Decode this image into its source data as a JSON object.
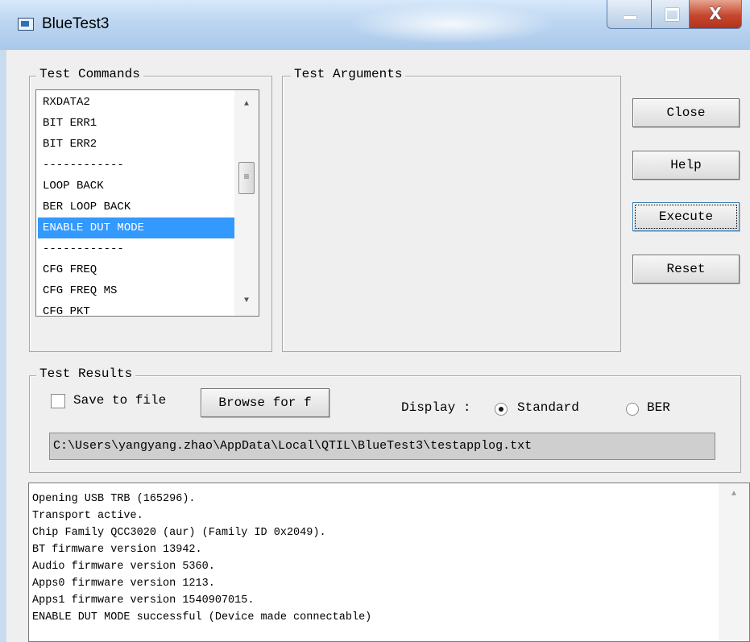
{
  "window": {
    "title": "BlueTest3",
    "controls": {
      "minimize": "",
      "maximize": "",
      "close": "X"
    }
  },
  "test_commands": {
    "legend": "Test Commands",
    "items": [
      "RXDATA2",
      "BIT ERR1",
      "BIT ERR2",
      "------------",
      "LOOP BACK",
      "BER LOOP BACK",
      "ENABLE DUT MODE",
      "------------",
      "CFG FREQ",
      "CFG FREQ MS",
      "CFG PKT"
    ],
    "selected_index": 6
  },
  "test_arguments": {
    "legend": "Test Arguments"
  },
  "buttons": {
    "close": "Close",
    "help": "Help",
    "execute": "Execute",
    "reset": "Reset"
  },
  "test_results": {
    "legend": "Test Results",
    "save_to_file_label": "Save to file",
    "save_to_file_checked": false,
    "browse_label": "Browse for f",
    "display_label": "Display :",
    "standard_label": "Standard",
    "ber_label": "BER",
    "selected_display": "Standard",
    "log_path": "C:\\Users\\yangyang.zhao\\AppData\\Local\\QTIL\\BlueTest3\\testapplog.txt"
  },
  "log_lines": [
    "Opening USB TRB (165296).",
    "Transport active.",
    "Chip Family QCC3020 (aur) (Family ID 0x2049).",
    "BT firmware version 13942.",
    "Audio firmware version 5360.",
    "Apps0 firmware version 1213.",
    "Apps1 firmware version 1540907015.",
    "ENABLE DUT MODE successful (Device made connectable)"
  ]
}
